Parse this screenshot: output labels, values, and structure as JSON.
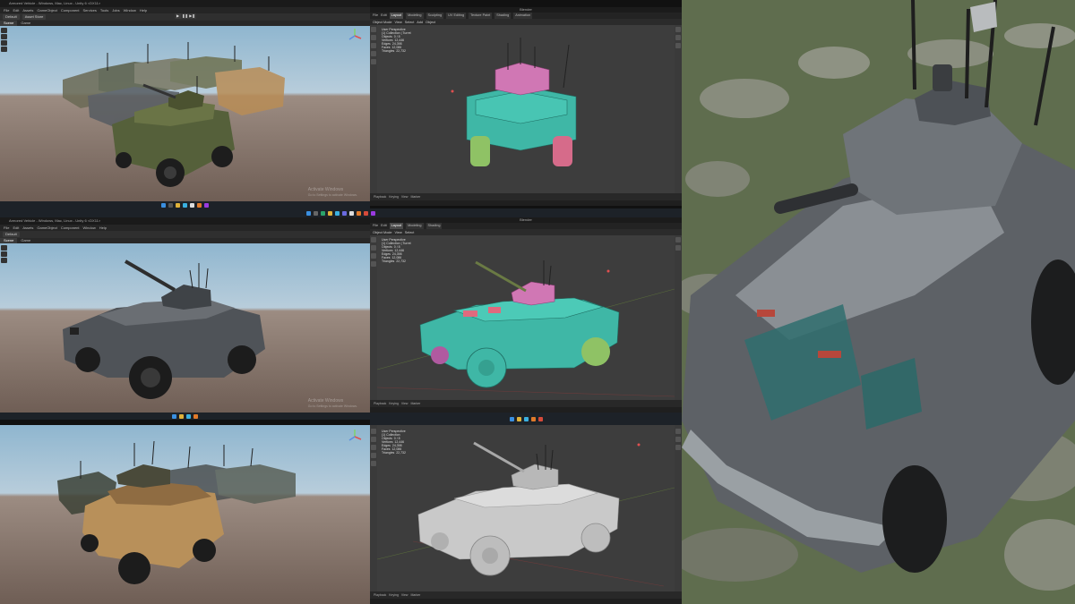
{
  "unity": {
    "title": "Armored Vehicle - Windows, Mac, Linux - Unity 6 <DX11>",
    "menu": [
      "File",
      "Edit",
      "Assets",
      "GameObject",
      "Component",
      "Services",
      "Tools",
      "Jobs",
      "Window",
      "Help"
    ],
    "toolbar_chips": [
      "Default",
      "Asset Store"
    ],
    "tabs": [
      "Scene",
      "Game"
    ],
    "watermark": "Activate Windows",
    "watermark_sub": "Go to Settings to activate Windows."
  },
  "blender": {
    "title": "Blender",
    "workspaces": [
      "Layout",
      "Modeling",
      "Sculpting",
      "UV Editing",
      "Texture Paint",
      "Shading",
      "Animation",
      "Rendering",
      "Compositing",
      "Geometry Nodes",
      "Scripting"
    ],
    "menu": [
      "File",
      "Edit",
      "Render",
      "Window",
      "Help"
    ],
    "header": [
      "Object Mode",
      "View",
      "Select",
      "Add",
      "Object"
    ],
    "timeline": [
      "Playback",
      "Keying",
      "View",
      "Marker"
    ],
    "stats_panels": [
      [
        "User Perspective",
        "(1) Collection | Turret",
        "",
        "Objects  0 / 8",
        "Vertices  12,446",
        "Edges  24,398",
        "Faces  12,086",
        "Triangles  22,732"
      ],
      [
        "User Perspective",
        "(1) Collection | Turret",
        "",
        "Objects  0 / 8",
        "Vertices  12,446",
        "Edges  24,398",
        "Faces  12,086",
        "Triangles  22,732"
      ],
      [
        "User Perspective",
        "(1) Collection",
        "",
        "Objects  0 / 8",
        "Vertices  12,446",
        "Edges  24,398",
        "Faces  12,086",
        "Triangles  22,732"
      ]
    ]
  },
  "colors": {
    "teal_mesh": "#3fb7a6",
    "pink_turret": "#d077b4",
    "green_wheels": "#8fc265",
    "camo_green": "#55603a",
    "camo_tan": "#b8905a",
    "gray_vehicle": "#5d6166",
    "clay": "#c9c9c9"
  }
}
